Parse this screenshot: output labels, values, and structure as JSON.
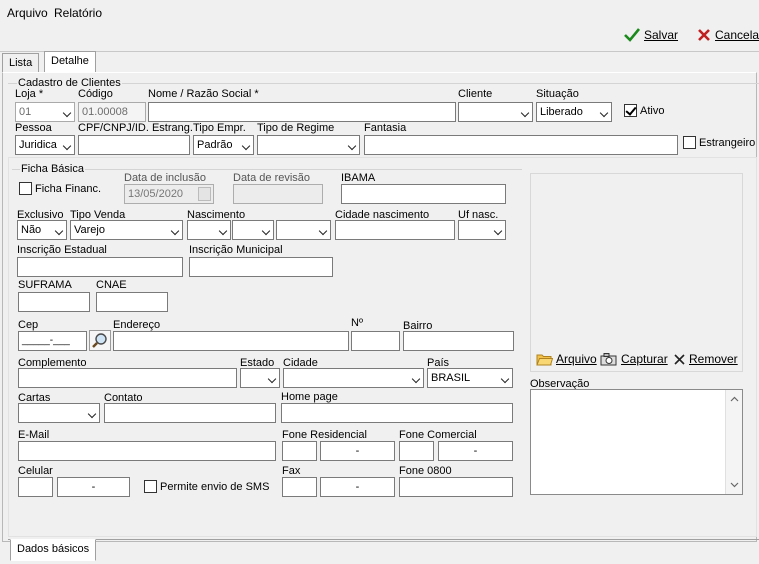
{
  "menu": {
    "arquivo": "Arquivo",
    "relatorio": "Relatório"
  },
  "toolbar": {
    "salvar": "Salvar",
    "cancelar": "Cancelar"
  },
  "tabs": {
    "lista": "Lista",
    "detalhe": "Detalhe"
  },
  "cadastro": {
    "group_title": "Cadastro de Clientes",
    "loja_label": "Loja *",
    "loja_value": "01",
    "codigo_label": "Código",
    "codigo_value": "01.00008",
    "nome_label": "Nome / Razão Social *",
    "nome_value": "",
    "cliente_label": "Cliente",
    "cliente_value": "",
    "situacao_label": "Situação",
    "situacao_value": "Liberado",
    "ativo_label": "Ativo",
    "ativo_checked": true,
    "pessoa_label": "Pessoa",
    "pessoa_value": "Juridica",
    "cpf_label": "CPF/CNPJ/ID. Estrang.",
    "cpf_value": "",
    "tipo_empr_label": "Tipo Empr.",
    "tipo_empr_value": "Padrão",
    "tipo_regime_label": "Tipo de Regime",
    "tipo_regime_value": "",
    "fantasia_label": "Fantasia",
    "fantasia_value": "",
    "estrangeiro_label": "Estrangeiro"
  },
  "ficha": {
    "group_title": "Ficha Básica",
    "ficha_financ_label": "Ficha Financ.",
    "data_inclusao_label": "Data de inclusão",
    "data_inclusao_value": "13/05/2020",
    "data_revisao_label": "Data de revisão",
    "data_revisao_value": "",
    "ibama_label": "IBAMA",
    "ibama_value": "",
    "exclusivo_label": "Exclusivo",
    "exclusivo_value": "Não",
    "tipo_venda_label": "Tipo Venda",
    "tipo_venda_value": "Varejo",
    "nascimento_label": "Nascimento",
    "cidade_nasc_label": "Cidade nascimento",
    "cidade_nasc_value": "",
    "uf_nasc_label": "Uf nasc.",
    "insc_estadual_label": "Inscrição Estadual",
    "insc_municipal_label": "Inscrição Municipal",
    "suframa_label": "SUFRAMA",
    "cnae_label": "CNAE",
    "cep_label": "Cep",
    "cep_mask": "_____-___",
    "endereco_label": "Endereço",
    "numero_label": "Nº",
    "bairro_label": "Bairro",
    "complemento_label": "Complemento",
    "estado_label": "Estado",
    "cidade_label": "Cidade",
    "pais_label": "País",
    "pais_value": "BRASIL",
    "cartas_label": "Cartas",
    "contato_label": "Contato",
    "homepage_label": "Home page",
    "email_label": "E-Mail",
    "fone_res_label": "Fone Residencial",
    "fone_res_sep": "-",
    "fone_com_label": "Fone Comercial",
    "fone_com_sep": "-",
    "celular_label": "Celular",
    "celular_sep": "-",
    "sms_label": "Permite envio de SMS",
    "fax_label": "Fax",
    "fax_sep": "-",
    "fone0800_label": "Fone 0800"
  },
  "photo": {
    "arquivo": "Arquivo",
    "capturar": "Capturar",
    "remover": "Remover"
  },
  "observacao_label": "Observação",
  "bottom_tab": "Dados básicos"
}
